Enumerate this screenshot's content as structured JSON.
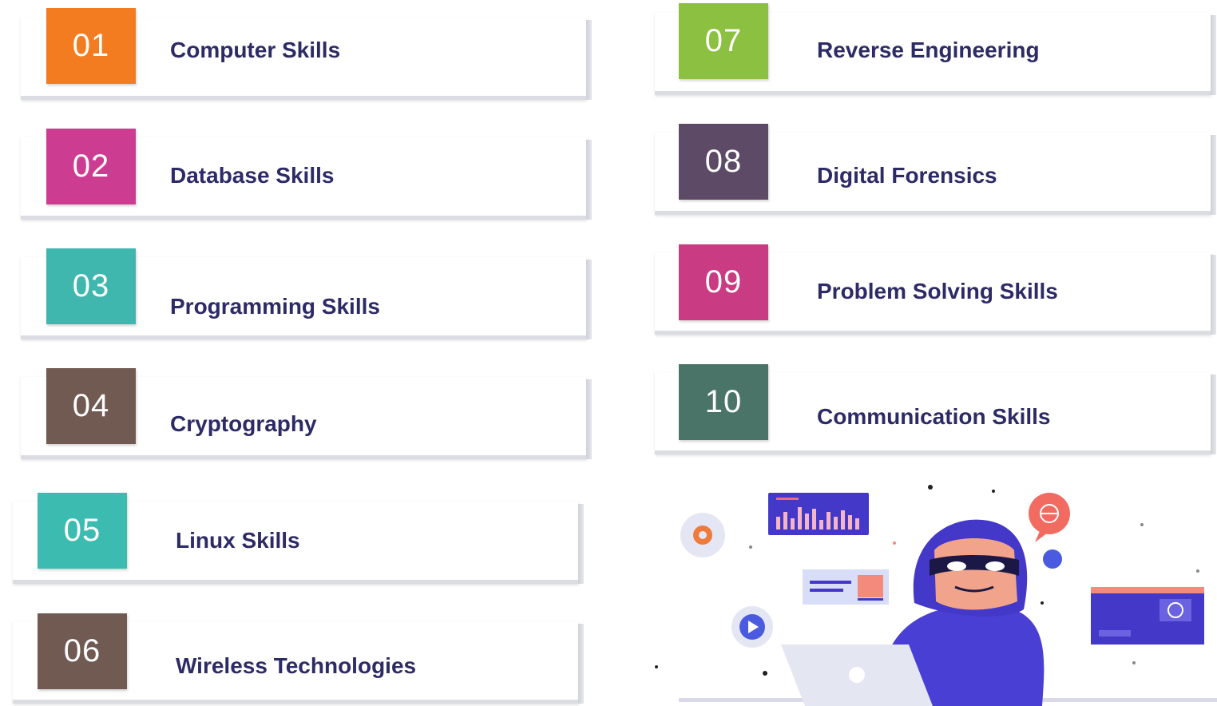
{
  "items": [
    {
      "num": "01",
      "label": "Computer Skills",
      "color": "#f47c20"
    },
    {
      "num": "02",
      "label": "Database Skills",
      "color": "#cc3d92"
    },
    {
      "num": "03",
      "label": "Programming Skills",
      "color": "#3fb6ae"
    },
    {
      "num": "04",
      "label": "Cryptography",
      "color": "#715a52"
    },
    {
      "num": "05",
      "label": "Linux Skills",
      "color": "#3cbcb0"
    },
    {
      "num": "06",
      "label": "Wireless Technologies",
      "color": "#715a52"
    },
    {
      "num": "07",
      "label": "Reverse Engineering",
      "color": "#8bc040"
    },
    {
      "num": "08",
      "label": "Digital Forensics",
      "color": "#5d4a66"
    },
    {
      "num": "09",
      "label": "Problem Solving Skills",
      "color": "#c93b82"
    },
    {
      "num": "10",
      "label": "Communication Skills",
      "color": "#4b7468"
    }
  ],
  "illustration": {
    "icons": [
      "hacker-figure-icon",
      "laptop-icon",
      "bar-chart-panel-icon",
      "browser-window-icon",
      "play-button-icon",
      "gear-bubble-icon",
      "globe-bubble-icon"
    ],
    "accent_color": "#4b3fd0"
  }
}
